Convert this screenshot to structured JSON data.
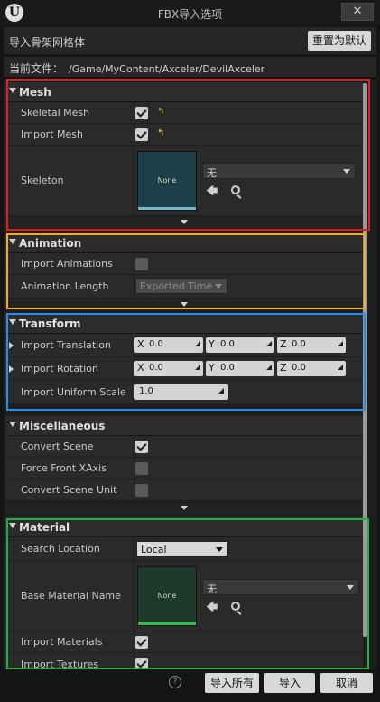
{
  "window": {
    "title": "FBX导入选项",
    "logo_glyph": "U",
    "close_glyph": "✕"
  },
  "header": {
    "label": "导入骨架网格体",
    "reset_label": "重置为默认"
  },
  "file": {
    "label": "当前文件：",
    "path": "/Game/MyContent/Axceler/DevilAxceler"
  },
  "sections": {
    "mesh": {
      "title": "Mesh",
      "skeletal_mesh": {
        "label": "Skeletal Mesh",
        "checked": true
      },
      "import_mesh": {
        "label": "Import Mesh",
        "checked": true
      },
      "skeleton": {
        "label": "Skeleton",
        "thumb_text": "None",
        "value": "无"
      }
    },
    "animation": {
      "title": "Animation",
      "import_animations": {
        "label": "Import Animations",
        "checked": false
      },
      "animation_length": {
        "label": "Animation Length",
        "value": "Exported Time"
      }
    },
    "transform": {
      "title": "Transform",
      "import_translation": {
        "label": "Import Translation",
        "x": "0.0",
        "y": "0.0",
        "z": "0.0"
      },
      "import_rotation": {
        "label": "Import Rotation",
        "x": "0.0",
        "y": "0.0",
        "z": "0.0"
      },
      "import_uniform_scale": {
        "label": "Import Uniform Scale",
        "value": "1.0"
      },
      "axis_x": "X",
      "axis_y": "Y",
      "axis_z": "Z"
    },
    "misc": {
      "title": "Miscellaneous",
      "convert_scene": {
        "label": "Convert Scene",
        "checked": true
      },
      "force_front_xaxis": {
        "label": "Force Front XAxis",
        "checked": false
      },
      "convert_scene_unit": {
        "label": "Convert Scene Unit",
        "checked": false
      }
    },
    "material": {
      "title": "Material",
      "search_location": {
        "label": "Search Location",
        "value": "Local"
      },
      "base_material_name": {
        "label": "Base Material Name",
        "thumb_text": "None",
        "value": "无"
      },
      "import_materials": {
        "label": "Import Materials",
        "checked": true
      },
      "import_textures": {
        "label": "Import Textures",
        "checked": true
      }
    }
  },
  "footer": {
    "help_glyph": "?",
    "import_all": "导入所有",
    "import": "导入",
    "cancel": "取消"
  },
  "revert_glyph": "↰",
  "arrow_glyph": "🡄",
  "highlight_colors": {
    "mesh": "#e02020",
    "animation": "#f0b020",
    "transform": "#2a8ee8",
    "material": "#20b040"
  }
}
